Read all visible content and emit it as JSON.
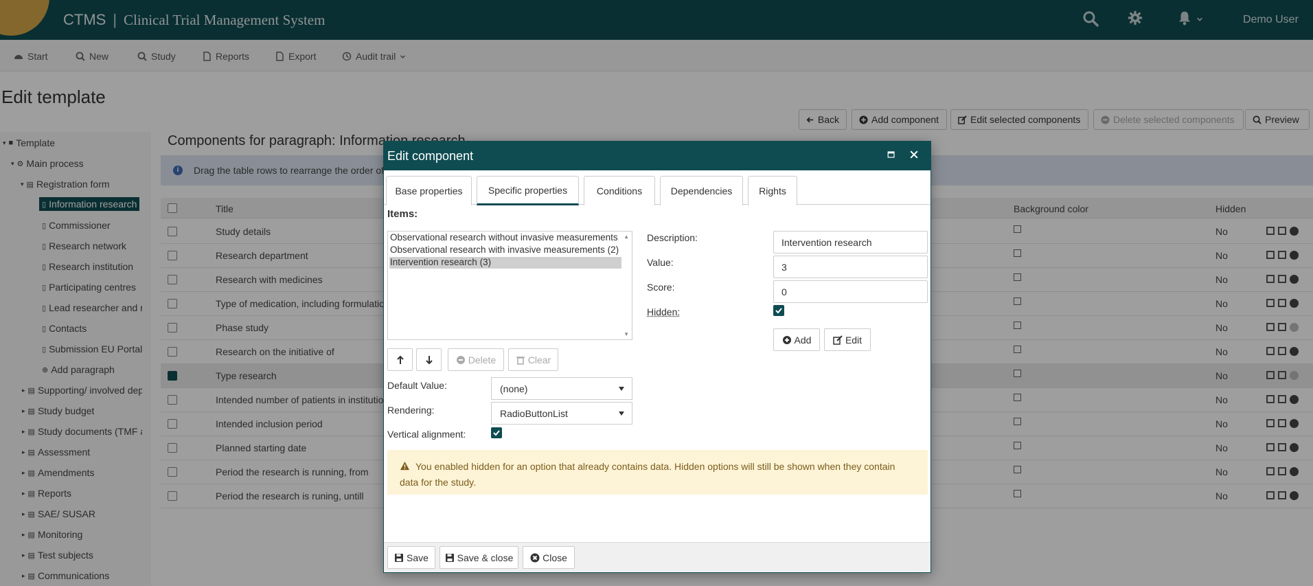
{
  "header": {
    "brand": "CTMS",
    "separator": "|",
    "subtitle": "Clinical Trial Management System",
    "user": "Demo User"
  },
  "toolbar": {
    "start": "Start",
    "new": "New",
    "study": "Study",
    "reports": "Reports",
    "export": "Export",
    "audit": "Audit trail"
  },
  "page": {
    "title": "Edit template",
    "actions": {
      "back": "Back",
      "add_component": "Add component",
      "edit_selected": "Edit selected components",
      "delete_selected": "Delete selected components",
      "preview": "Preview"
    }
  },
  "sidebar": {
    "items": [
      {
        "label": "Template"
      },
      {
        "label": "Main process"
      },
      {
        "label": "Registration form"
      },
      {
        "label": "Information research"
      },
      {
        "label": "Commissioner"
      },
      {
        "label": "Research network"
      },
      {
        "label": "Research institution"
      },
      {
        "label": "Participating centres"
      },
      {
        "label": "Lead researcher and re"
      },
      {
        "label": "Contacts"
      },
      {
        "label": "Submission EU Portal"
      },
      {
        "label": "Add paragraph"
      },
      {
        "label": "Supporting/ involved dep"
      },
      {
        "label": "Study budget"
      },
      {
        "label": "Study documents (TMF a"
      },
      {
        "label": "Assessment"
      },
      {
        "label": "Amendments"
      },
      {
        "label": "Reports"
      },
      {
        "label": "SAE/ SUSAR"
      },
      {
        "label": "Monitoring"
      },
      {
        "label": "Test subjects"
      },
      {
        "label": "Communications"
      }
    ]
  },
  "components": {
    "title": "Components for paragraph: Information research",
    "info": "Drag the table rows to rearrange the order of",
    "columns": {
      "title": "Title",
      "background": "Background color",
      "hidden": "Hidden"
    },
    "rows": [
      {
        "title": "Study details",
        "hidden": "No"
      },
      {
        "title": "Research department",
        "hidden": "No"
      },
      {
        "title": "Research with medicines",
        "hidden": "No"
      },
      {
        "title": "Type of medication, including formulatio",
        "hidden": "No"
      },
      {
        "title": "Phase study",
        "hidden": "No"
      },
      {
        "title": "Research on the initiative of",
        "hidden": "No"
      },
      {
        "title": "Type research",
        "hidden": "No"
      },
      {
        "title": "Intended number of patients in institutio",
        "hidden": "No"
      },
      {
        "title": "Intended inclusion period",
        "hidden": "No"
      },
      {
        "title": "Planned starting date",
        "hidden": "No"
      },
      {
        "title": "Period the research is running, from",
        "hidden": "No"
      },
      {
        "title": "Period the research is runing, untill",
        "hidden": "No"
      }
    ]
  },
  "modal": {
    "title": "Edit component",
    "tabs": [
      "Base properties",
      "Specific properties",
      "Conditions",
      "Dependencies",
      "Rights"
    ],
    "items_label": "Items:",
    "items": [
      "Observational research without invasive measurements",
      "Observational research with invasive measurements (2)",
      "Intervention research (3)"
    ],
    "description_label": "Description:",
    "description_value": "Intervention research",
    "value_label": "Value:",
    "value_value": "3",
    "score_label": "Score:",
    "score_value": "0",
    "hidden_label": "Hidden:",
    "add": "Add",
    "edit": "Edit",
    "delete": "Delete",
    "clear": "Clear",
    "default_label": "Default Value:",
    "default_value": "(none)",
    "rendering_label": "Rendering:",
    "rendering_value": "RadioButtonList",
    "vertical_label": "Vertical alignment:",
    "warning": "You enabled hidden for an option that already contains data. Hidden options will still be shown when they contain data for the study.",
    "save": "Save",
    "save_close": "Save & close",
    "close": "Close"
  },
  "colors": {
    "primary": "#0f4c52",
    "accent": "#d4a64a",
    "warning_bg": "#fdf3d6"
  }
}
